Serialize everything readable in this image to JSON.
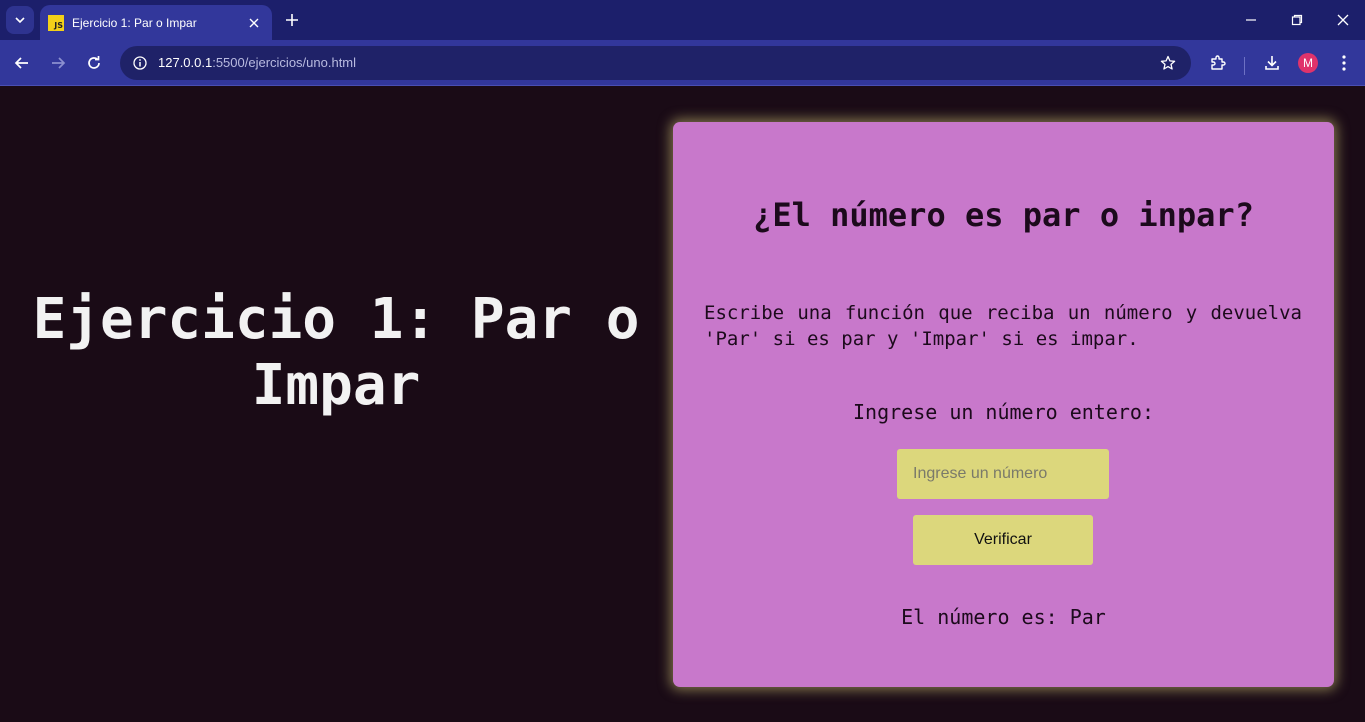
{
  "browser": {
    "tab": {
      "favicon_text": "JS",
      "title": "Ejercicio 1: Par o Impar"
    },
    "url": {
      "host": "127.0.0.1",
      "rest": ":5500/ejercicios/uno.html"
    },
    "profile_initial": "M",
    "colors": {
      "tabstrip": "#1c1f6b",
      "toolbar": "#32379b",
      "omnibox": "#1f2268",
      "avatar": "#e0336b"
    },
    "icons": [
      "tab-search-icon",
      "close-icon",
      "plus-icon",
      "minimize-icon",
      "restore-icon",
      "window-close-icon",
      "back-arrow-icon",
      "forward-arrow-icon",
      "reload-icon",
      "site-info-icon",
      "star-icon",
      "extensions-icon",
      "download-icon",
      "kebab-menu-icon"
    ]
  },
  "page": {
    "heading": "Ejercicio 1: Par o Impar",
    "card": {
      "title": "¿El número es par o inpar?",
      "description": "Escribe una función que reciba un número y devuelva 'Par' si es par y 'Impar' si es impar.",
      "input_label": "Ingrese un número entero:",
      "input_placeholder": "Ingrese un número",
      "input_value": "",
      "button_label": "Verificar",
      "result": "El número es: Par"
    },
    "colors": {
      "background": "#1a0b16",
      "card": "#c878cb",
      "input_and_button": "#dcd77c",
      "heading_text": "#f2f2f2"
    }
  }
}
